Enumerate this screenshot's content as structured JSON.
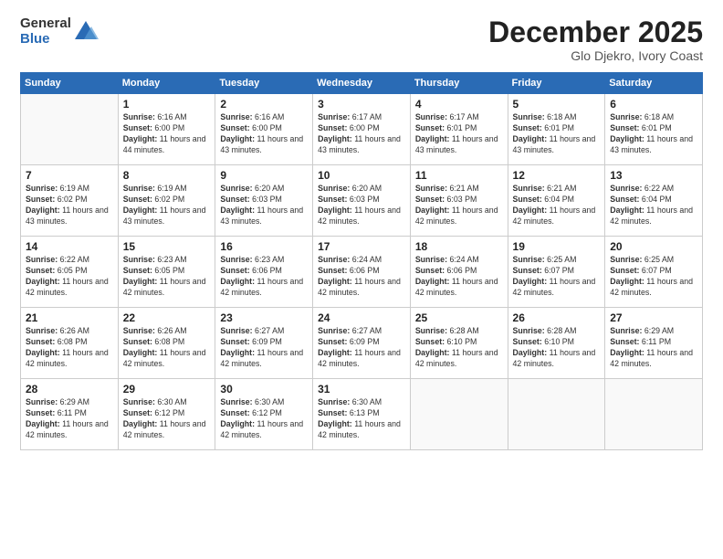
{
  "logo": {
    "general": "General",
    "blue": "Blue"
  },
  "title": "December 2025",
  "subtitle": "Glo Djekro, Ivory Coast",
  "weekdays": [
    "Sunday",
    "Monday",
    "Tuesday",
    "Wednesday",
    "Thursday",
    "Friday",
    "Saturday"
  ],
  "weeks": [
    [
      {
        "day": "",
        "sunrise": "",
        "sunset": "",
        "daylight": ""
      },
      {
        "day": "1",
        "sunrise": "6:16 AM",
        "sunset": "6:00 PM",
        "daylight": "11 hours and 44 minutes."
      },
      {
        "day": "2",
        "sunrise": "6:16 AM",
        "sunset": "6:00 PM",
        "daylight": "11 hours and 43 minutes."
      },
      {
        "day": "3",
        "sunrise": "6:17 AM",
        "sunset": "6:00 PM",
        "daylight": "11 hours and 43 minutes."
      },
      {
        "day": "4",
        "sunrise": "6:17 AM",
        "sunset": "6:01 PM",
        "daylight": "11 hours and 43 minutes."
      },
      {
        "day": "5",
        "sunrise": "6:18 AM",
        "sunset": "6:01 PM",
        "daylight": "11 hours and 43 minutes."
      },
      {
        "day": "6",
        "sunrise": "6:18 AM",
        "sunset": "6:01 PM",
        "daylight": "11 hours and 43 minutes."
      }
    ],
    [
      {
        "day": "7",
        "sunrise": "6:19 AM",
        "sunset": "6:02 PM",
        "daylight": "11 hours and 43 minutes."
      },
      {
        "day": "8",
        "sunrise": "6:19 AM",
        "sunset": "6:02 PM",
        "daylight": "11 hours and 43 minutes."
      },
      {
        "day": "9",
        "sunrise": "6:20 AM",
        "sunset": "6:03 PM",
        "daylight": "11 hours and 43 minutes."
      },
      {
        "day": "10",
        "sunrise": "6:20 AM",
        "sunset": "6:03 PM",
        "daylight": "11 hours and 42 minutes."
      },
      {
        "day": "11",
        "sunrise": "6:21 AM",
        "sunset": "6:03 PM",
        "daylight": "11 hours and 42 minutes."
      },
      {
        "day": "12",
        "sunrise": "6:21 AM",
        "sunset": "6:04 PM",
        "daylight": "11 hours and 42 minutes."
      },
      {
        "day": "13",
        "sunrise": "6:22 AM",
        "sunset": "6:04 PM",
        "daylight": "11 hours and 42 minutes."
      }
    ],
    [
      {
        "day": "14",
        "sunrise": "6:22 AM",
        "sunset": "6:05 PM",
        "daylight": "11 hours and 42 minutes."
      },
      {
        "day": "15",
        "sunrise": "6:23 AM",
        "sunset": "6:05 PM",
        "daylight": "11 hours and 42 minutes."
      },
      {
        "day": "16",
        "sunrise": "6:23 AM",
        "sunset": "6:06 PM",
        "daylight": "11 hours and 42 minutes."
      },
      {
        "day": "17",
        "sunrise": "6:24 AM",
        "sunset": "6:06 PM",
        "daylight": "11 hours and 42 minutes."
      },
      {
        "day": "18",
        "sunrise": "6:24 AM",
        "sunset": "6:06 PM",
        "daylight": "11 hours and 42 minutes."
      },
      {
        "day": "19",
        "sunrise": "6:25 AM",
        "sunset": "6:07 PM",
        "daylight": "11 hours and 42 minutes."
      },
      {
        "day": "20",
        "sunrise": "6:25 AM",
        "sunset": "6:07 PM",
        "daylight": "11 hours and 42 minutes."
      }
    ],
    [
      {
        "day": "21",
        "sunrise": "6:26 AM",
        "sunset": "6:08 PM",
        "daylight": "11 hours and 42 minutes."
      },
      {
        "day": "22",
        "sunrise": "6:26 AM",
        "sunset": "6:08 PM",
        "daylight": "11 hours and 42 minutes."
      },
      {
        "day": "23",
        "sunrise": "6:27 AM",
        "sunset": "6:09 PM",
        "daylight": "11 hours and 42 minutes."
      },
      {
        "day": "24",
        "sunrise": "6:27 AM",
        "sunset": "6:09 PM",
        "daylight": "11 hours and 42 minutes."
      },
      {
        "day": "25",
        "sunrise": "6:28 AM",
        "sunset": "6:10 PM",
        "daylight": "11 hours and 42 minutes."
      },
      {
        "day": "26",
        "sunrise": "6:28 AM",
        "sunset": "6:10 PM",
        "daylight": "11 hours and 42 minutes."
      },
      {
        "day": "27",
        "sunrise": "6:29 AM",
        "sunset": "6:11 PM",
        "daylight": "11 hours and 42 minutes."
      }
    ],
    [
      {
        "day": "28",
        "sunrise": "6:29 AM",
        "sunset": "6:11 PM",
        "daylight": "11 hours and 42 minutes."
      },
      {
        "day": "29",
        "sunrise": "6:30 AM",
        "sunset": "6:12 PM",
        "daylight": "11 hours and 42 minutes."
      },
      {
        "day": "30",
        "sunrise": "6:30 AM",
        "sunset": "6:12 PM",
        "daylight": "11 hours and 42 minutes."
      },
      {
        "day": "31",
        "sunrise": "6:30 AM",
        "sunset": "6:13 PM",
        "daylight": "11 hours and 42 minutes."
      },
      {
        "day": "",
        "sunrise": "",
        "sunset": "",
        "daylight": ""
      },
      {
        "day": "",
        "sunrise": "",
        "sunset": "",
        "daylight": ""
      },
      {
        "day": "",
        "sunrise": "",
        "sunset": "",
        "daylight": ""
      }
    ]
  ]
}
